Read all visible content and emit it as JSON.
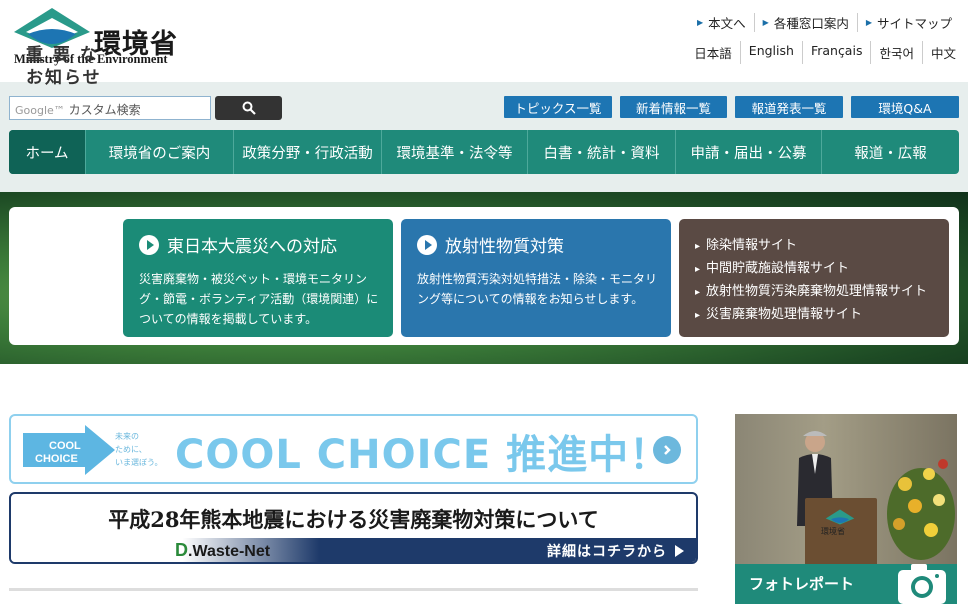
{
  "header": {
    "logo_jp": "環境省",
    "logo_en": "Ministry of the Environment",
    "util_links": [
      "本文へ",
      "各種窓口案内",
      "サイトマップ"
    ],
    "languages": [
      "日本語",
      "English",
      "Français",
      "한국어",
      "中文"
    ]
  },
  "search": {
    "google_label": "Google™",
    "placeholder": "カスタム検索",
    "button_icon": "search-icon"
  },
  "quick_links": [
    "トピックス一覧",
    "新着情報一覧",
    "報道発表一覧",
    "環境Q&A"
  ],
  "nav": [
    "ホーム",
    "環境省のご案内",
    "政策分野・行政活動",
    "環境基準・法令等",
    "白書・統計・資料",
    "申請・届出・公募",
    "報道・広報"
  ],
  "important": {
    "label_line1": "重 要 な",
    "label_line2": "お知らせ",
    "card1": {
      "title": "東日本大震災への対応",
      "desc": "災害廃棄物・被災ペット・環境モニタリング・節電・ボランティア活動（環境関連）についての情報を掲載しています。"
    },
    "card2": {
      "title": "放射性物質対策",
      "desc": "放射性物質汚染対処特措法・除染・モニタリング等についての情報をお知らせします。"
    },
    "card3_links": [
      "除染情報サイト",
      "中間貯蔵施設情報サイト",
      "放射性物質汚染廃棄物処理情報サイト",
      "災害廃棄物処理情報サイト"
    ]
  },
  "banners": {
    "cool_logo_1": "COOL",
    "cool_logo_2": "CHOICE",
    "cool_small": "未来の\nために、\nいま選ぼう。",
    "cool_text": "COOL CHOICE 推進中！",
    "waste_title": "平成28年熊本地震における災害廃棄物対策について",
    "waste_logo_d": "D",
    "waste_logo": ".Waste-Net",
    "waste_more": "詳細はコチラから"
  },
  "photo": {
    "podium_label": "環境省",
    "caption": "フォトレポート"
  },
  "colors": {
    "nav_green": "#1f8a7a",
    "quick_blue": "#1d75b3",
    "card_green": "#1b8b77",
    "card_blue": "#2a76ad",
    "card_brown": "#5a4a44"
  }
}
